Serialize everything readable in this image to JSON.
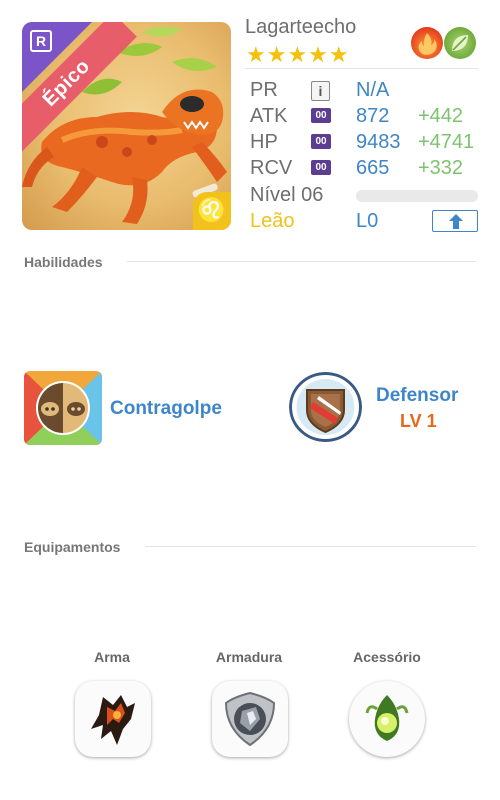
{
  "unit": {
    "name": "Lagarteecho",
    "stars": "★★★★★",
    "rarity": "Épico",
    "rank_badge": "R",
    "zodiac_symbol": "♌",
    "elements": [
      "fire-icon",
      "leaf-icon"
    ]
  },
  "stats": {
    "pr": {
      "label": "PR",
      "value": "N/A",
      "info": "i"
    },
    "atk": {
      "label": "ATK",
      "plus": "00",
      "value": "872",
      "bonus": "+442"
    },
    "hp": {
      "label": "HP",
      "plus": "00",
      "value": "9483",
      "bonus": "+4741"
    },
    "rcv": {
      "label": "RCV",
      "plus": "00",
      "value": "665",
      "bonus": "+332"
    },
    "level": {
      "label": "Nível 06",
      "progress": 0
    },
    "zodiac": {
      "name": "Leão",
      "awaken": "L0"
    }
  },
  "skills": {
    "title": "Habilidades",
    "active": {
      "name": "Contragolpe",
      "icon": "pig-face-icon"
    },
    "leader": {
      "name": "Defensor",
      "level": "LV 1",
      "icon": "shield-icon"
    }
  },
  "equipment": {
    "title": "Equipamentos",
    "slots": [
      {
        "label": "Arma",
        "icon": "weapon-claw-icon"
      },
      {
        "label": "Armadura",
        "icon": "armor-shield-icon"
      },
      {
        "label": "Acessório",
        "icon": "accessory-orb-icon"
      }
    ]
  },
  "colors": {
    "accent_blue": "#3f86c8",
    "bonus_green": "#7cc36e",
    "zodiac_yellow": "#f1c21b",
    "rarity_red": "#e85d6a",
    "level_orange": "#e8661a",
    "star_gold": "#f4c20d"
  }
}
